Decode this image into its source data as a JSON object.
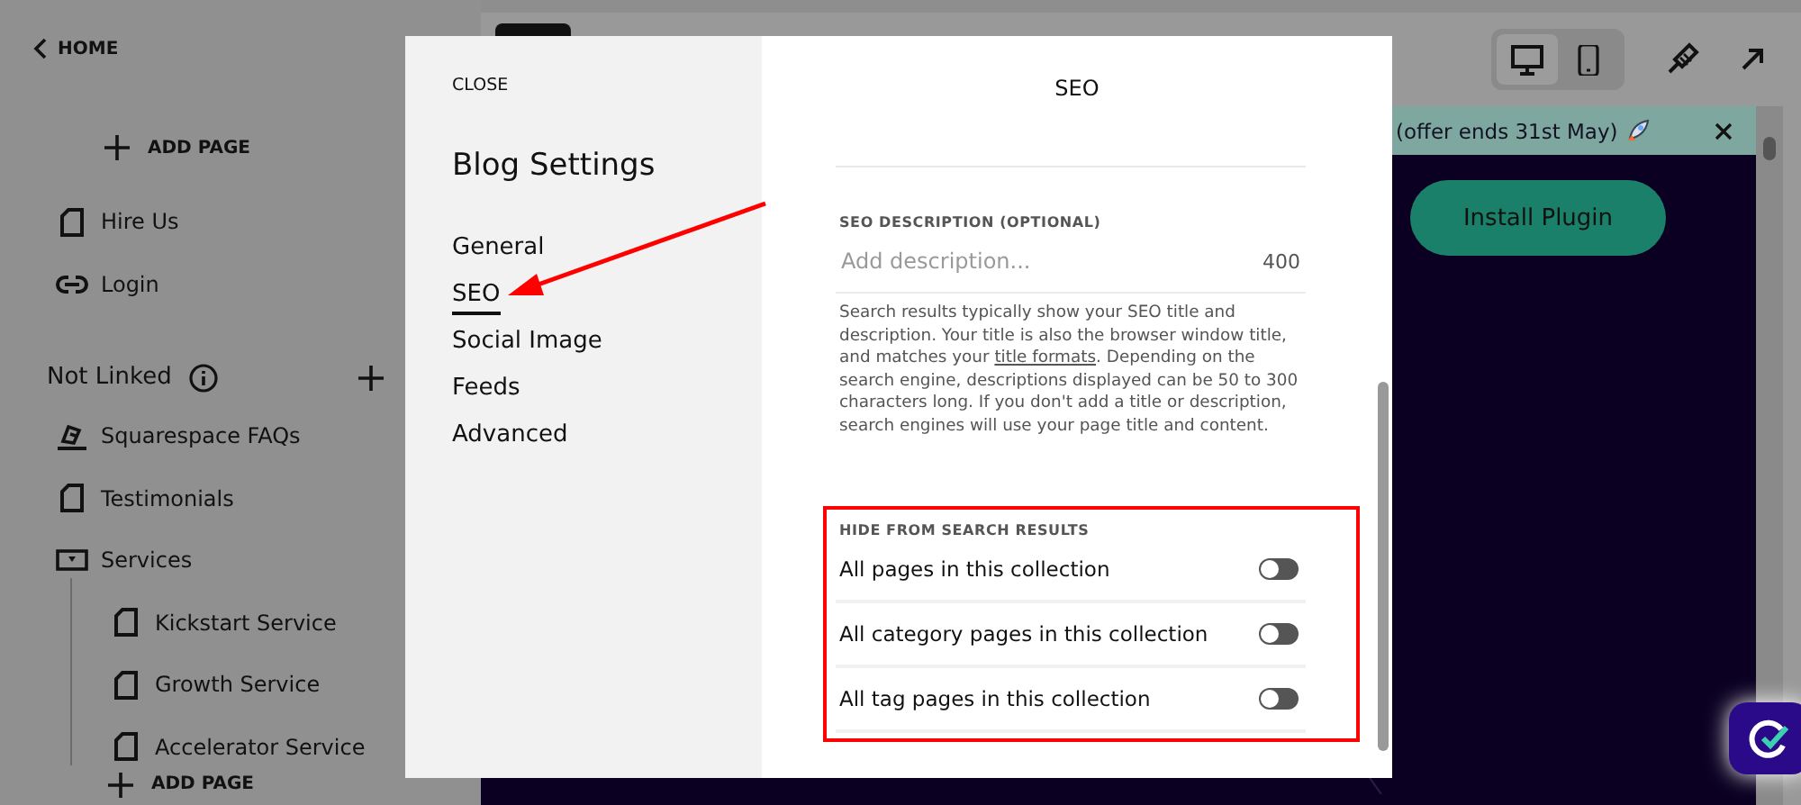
{
  "sidebar": {
    "back": "HOME",
    "add_page": "ADD PAGE",
    "items": [
      {
        "label": "Hire Us",
        "kind": "page"
      },
      {
        "label": "Login",
        "kind": "link"
      }
    ],
    "section": {
      "title": "Not Linked",
      "items": [
        {
          "label": "Squarespace FAQs",
          "kind": "blog"
        },
        {
          "label": "Testimonials",
          "kind": "page"
        },
        {
          "label": "Services",
          "kind": "folder",
          "children": [
            {
              "label": "Kickstart Service",
              "kind": "page"
            },
            {
              "label": "Growth Service",
              "kind": "page"
            },
            {
              "label": "Accelerator Service",
              "kind": "page"
            }
          ]
        }
      ]
    },
    "add_page_bottom": "ADD PAGE"
  },
  "preview": {
    "devices": [
      {
        "kind": "desktop",
        "selected": true
      },
      {
        "kind": "mobile",
        "selected": false
      }
    ],
    "banner": "(offer ends 31st May)",
    "button": "Install Plugin"
  },
  "modal": {
    "close": "CLOSE",
    "title": "Blog Settings",
    "nav": [
      {
        "label": "General",
        "selected": false
      },
      {
        "label": "SEO",
        "selected": true
      },
      {
        "label": "Social Image",
        "selected": false
      },
      {
        "label": "Feeds",
        "selected": false
      },
      {
        "label": "Advanced",
        "selected": false
      }
    ],
    "panel_title": "SEO",
    "description": {
      "label": "SEO DESCRIPTION (OPTIONAL)",
      "placeholder": "Add description...",
      "count": "400",
      "help_before": "Search results typically show your SEO title and description. Your title is also the browser window title, and matches your",
      "link": "title formats",
      "help_after": ". Depending on the search engine, descriptions displayed can be 50 to 300 characters long. If you don't add a title or description, search engines will use your page title and content."
    },
    "hide": {
      "label": "HIDE FROM SEARCH RESULTS",
      "toggles": [
        {
          "label": "All pages in this collection",
          "on": false
        },
        {
          "label": "All category pages in this collection",
          "on": false
        },
        {
          "label": "All tag pages in this collection",
          "on": false
        }
      ]
    }
  }
}
